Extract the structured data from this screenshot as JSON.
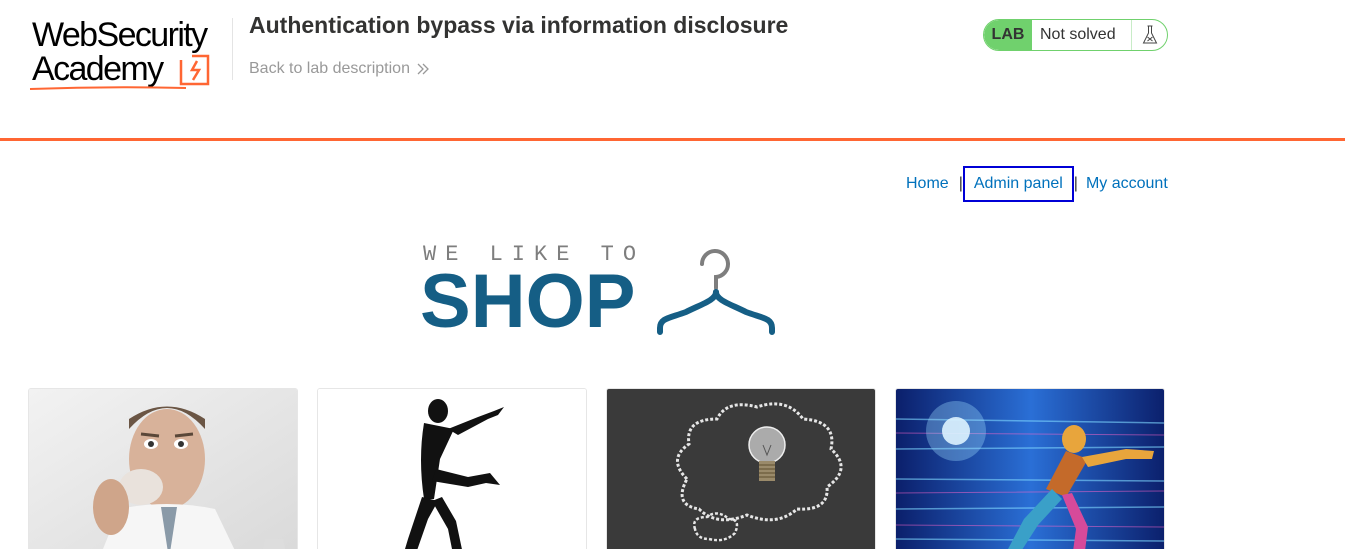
{
  "lab_header": {
    "logo_text_line1": "WebSecurity",
    "logo_text_line2": "Academy",
    "title": "Authentication bypass via information disclosure",
    "back_link_label": "Back to lab description",
    "status_badge": "LAB",
    "status_text": "Not solved",
    "icons": {
      "chevron": "double-chevron-right-icon",
      "flask": "flask-icon"
    }
  },
  "nav": {
    "home_label": "Home",
    "separator": "|",
    "admin_label": "Admin panel",
    "account_label": "My account"
  },
  "banner": {
    "small_text": "WE LIKE TO",
    "big_text": "SHOP",
    "icon": "hanger-icon"
  },
  "products": [
    {
      "image": "man-eating-cookie-image"
    },
    {
      "image": "silhouette-dancer-image"
    },
    {
      "image": "lightbulb-chalkboard-image"
    },
    {
      "image": "neon-superhero-image"
    }
  ],
  "colors": {
    "accent_orange": "#ff6633",
    "link_blue": "#0071bc",
    "status_green": "#70d16d",
    "shop_blue": "#155e85",
    "focus_outline": "#0000d6"
  }
}
